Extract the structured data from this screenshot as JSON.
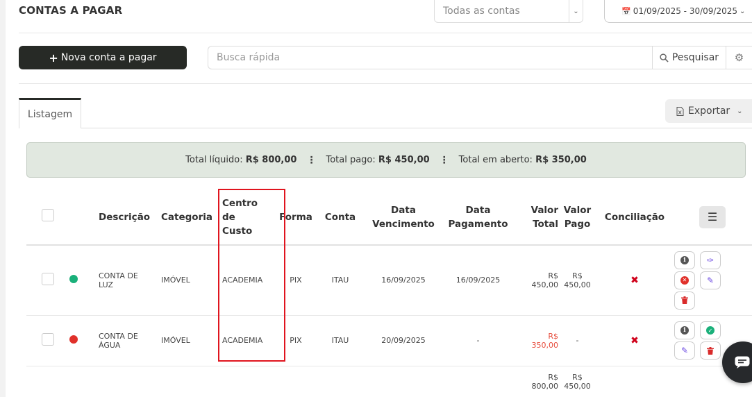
{
  "header": {
    "title": "CONTAS A PAGAR",
    "account_filter": "Todas as contas",
    "date_range": "01/09/2025 - 30/09/2025"
  },
  "toolbar": {
    "new_button": "Nova conta a pagar",
    "search_placeholder": "Busca rápida",
    "search_button": "Pesquisar"
  },
  "tabs": {
    "active": "Listagem",
    "export_button": "Exportar"
  },
  "summary": {
    "net_label": "Total líquido:",
    "net_value": "R$ 800,00",
    "paid_label": "Total pago:",
    "paid_value": "R$ 450,00",
    "open_label": "Total em aberto:",
    "open_value": "R$ 350,00"
  },
  "table": {
    "headers": {
      "descricao": "Descrição",
      "categoria": "Categoria",
      "centro_l1": "Centro",
      "centro_l2": "de",
      "centro_l3": "Custo",
      "forma": "Forma",
      "conta": "Conta",
      "venc_l1": "Data",
      "venc_l2": "Vencimento",
      "pag_l1": "Data",
      "pag_l2": "Pagamento",
      "vt_l1": "Valor",
      "vt_l2": "Total",
      "vp_l1": "Valor",
      "vp_l2": "Pago",
      "conciliacao": "Conciliação"
    },
    "rows": [
      {
        "status_color": "#1ab07a",
        "desc_l1": "CONTA DE",
        "desc_l2": "LUZ",
        "categoria": "IMÓVEL",
        "centro": "ACADEMIA",
        "forma": "PIX",
        "conta": "ITAU",
        "vencimento": "16/09/2025",
        "pagamento": "16/09/2025",
        "vt_l1": "R$",
        "vt_l2": "450,00",
        "vp_l1": "R$",
        "vp_l2": "450,00",
        "conciliacao": "✖"
      },
      {
        "status_color": "#e0302a",
        "desc_l1": "CONTA DE",
        "desc_l2": "ÁGUA",
        "categoria": "IMÓVEL",
        "centro": "ACADEMIA",
        "forma": "PIX",
        "conta": "ITAU",
        "vencimento": "20/09/2025",
        "pagamento": "-",
        "vt_l1": "R$",
        "vt_l2": "350,00",
        "vp_pending": "-",
        "conciliacao": "✖"
      }
    ],
    "totals": {
      "vt_l1": "R$",
      "vt_l2": "800,00",
      "vp_l1": "R$",
      "vp_l2": "450,00"
    }
  }
}
